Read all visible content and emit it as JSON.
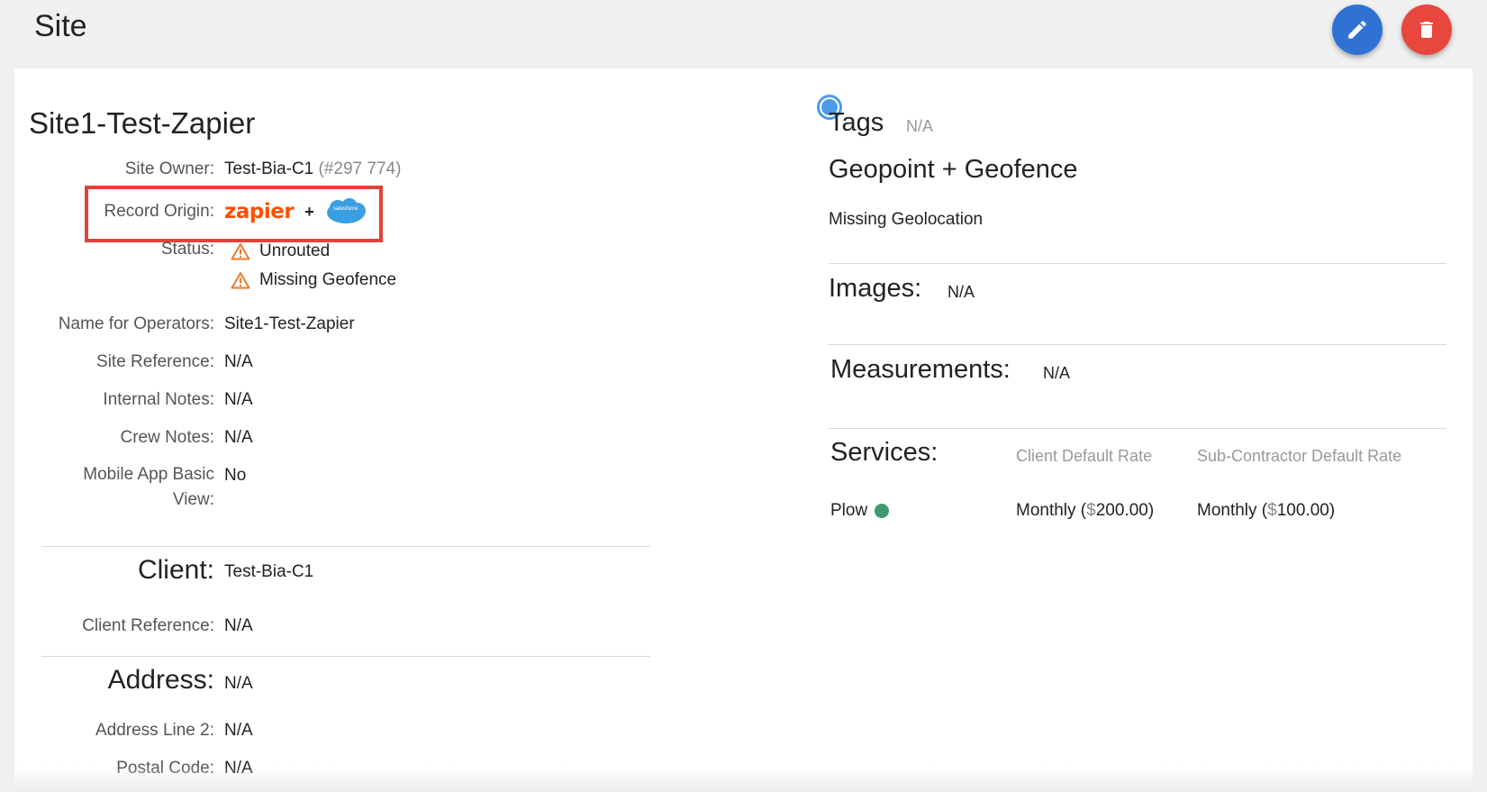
{
  "header": {
    "title": "Site"
  },
  "site": {
    "name": "Site1-Test-Zapier",
    "owner_label": "Site Owner:",
    "owner_value": "Test-Bia-C1",
    "owner_id": "(#297 774)",
    "origin_label": "Record Origin:",
    "origin_zapier": "zapier",
    "origin_plus": "+",
    "origin_salesforce": "salesforce",
    "status_label": "Status:",
    "status_1": "Unrouted",
    "status_2": "Missing Geofence",
    "operators_label": "Name for Operators:",
    "operators_value": "Site1-Test-Zapier",
    "reference_label": "Site Reference:",
    "reference_value": "N/A",
    "internal_label": "Internal Notes:",
    "internal_value": "N/A",
    "crew_label": "Crew Notes:",
    "crew_value": "N/A",
    "mobile_label": "Mobile App Basic View:",
    "mobile_value": "No"
  },
  "client": {
    "heading": "Client:",
    "value": "Test-Bia-C1",
    "ref_label": "Client Reference:",
    "ref_value": "N/A"
  },
  "address": {
    "heading": "Address:",
    "value": "N/A",
    "line2_label": "Address Line 2:",
    "line2_value": "N/A",
    "postal_label": "Postal Code:",
    "postal_value": "N/A"
  },
  "right": {
    "tags_label": "Tags",
    "tags_value": "N/A",
    "geo_heading": "Geopoint + Geofence",
    "geo_value": "Missing Geolocation",
    "images_label": "Images:",
    "images_value": "N/A",
    "measure_label": "Measurements:",
    "measure_value": "N/A",
    "services_label": "Services:",
    "col_client": "Client Default Rate",
    "col_sub": "Sub-Contractor Default Rate",
    "service_name": "Plow",
    "service_client_rate_pre": "Monthly (",
    "service_client_rate_cur": "$",
    "service_client_rate_amt": "200.00)",
    "service_sub_rate_pre": "Monthly (",
    "service_sub_rate_cur": "$",
    "service_sub_rate_amt": "100.00)"
  },
  "colors": {
    "edit_button": "#2f72d4",
    "delete_button": "#e8473d",
    "warning": "#ee7a2a",
    "highlight_box": "#e0433a",
    "service_active": "#3d9a6e"
  },
  "icons": {
    "edit": "pencil-icon",
    "delete": "trash-icon",
    "warning": "warning-triangle-icon",
    "salesforce": "salesforce-cloud-icon"
  }
}
